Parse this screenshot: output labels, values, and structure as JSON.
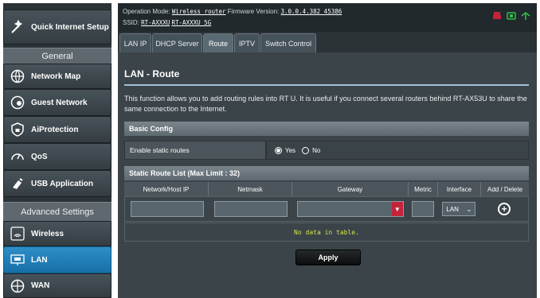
{
  "sidebar": {
    "quick_setup": "Quick Internet Setup",
    "general_header": "General",
    "items": [
      {
        "label": "Network Map"
      },
      {
        "label": "Guest Network"
      },
      {
        "label": "AiProtection"
      },
      {
        "label": "QoS"
      },
      {
        "label": "USB Application"
      }
    ],
    "advanced_header": "Advanced Settings",
    "adv_items": [
      {
        "label": "Wireless"
      },
      {
        "label": "LAN"
      },
      {
        "label": "WAN"
      }
    ]
  },
  "header": {
    "op_mode_label": "Operation Mode:",
    "op_mode_value": "Wireless router",
    "firmware_label": "Firmware Version:",
    "firmware_value": "3.0.0.4.382_45386",
    "ssid_label": "SSID:",
    "ssid_1": "RT-AXXXU",
    "ssid_2": "RT-AXXXU_5G"
  },
  "tabs": [
    "LAN IP",
    "DHCP Server",
    "Route",
    "IPTV",
    "Switch Control"
  ],
  "main": {
    "title": "LAN - Route",
    "description": "This function allows you to add routing rules into RT          U. It is useful if you connect several routers behind RT-AX53U to share the same connection to the Internet.",
    "basic_config": "Basic Config",
    "enable_static_label": "Enable static routes",
    "yes": "Yes",
    "no": "No",
    "static_list_title": "Static Route List (Max Limit : 32)",
    "columns": [
      "Network/Host IP",
      "Netmask",
      "Gateway",
      "Metric",
      "Interface",
      "Add / Delete"
    ],
    "interface_value": "LAN",
    "empty_text": "No data in table.",
    "apply": "Apply"
  },
  "colors": {
    "accent": "#1670a8",
    "dropdown_red": "#c4233c",
    "empty_text": "#d3e44c"
  }
}
